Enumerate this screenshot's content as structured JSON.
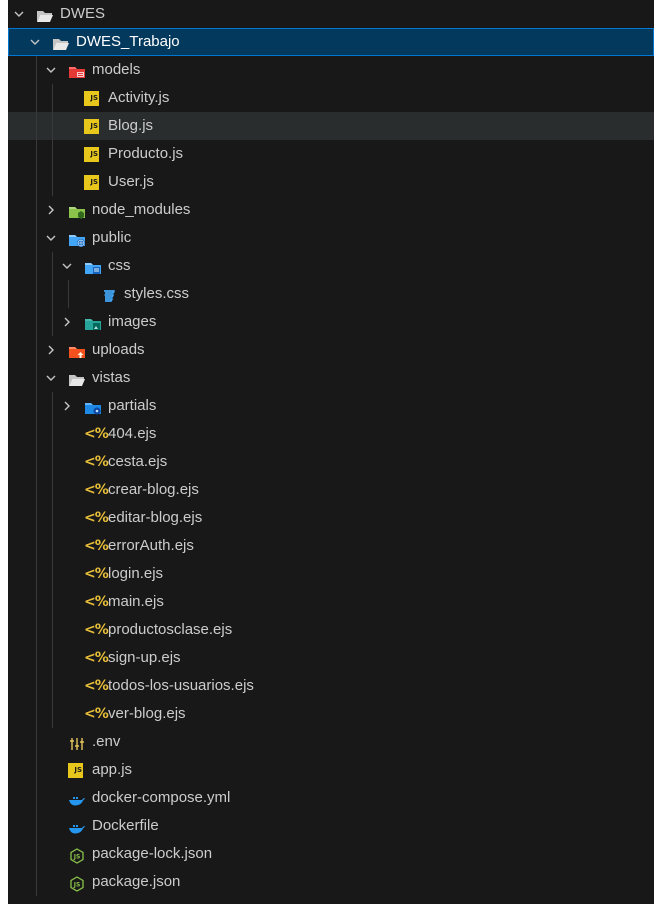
{
  "tree": [
    {
      "label": "DWES",
      "depth": 0,
      "kind": "folder",
      "icon": "folder-open-icon",
      "expanded": true
    },
    {
      "label": "DWES_Trabajo",
      "depth": 1,
      "kind": "folder",
      "icon": "folder-open-icon",
      "expanded": true,
      "selected": true
    },
    {
      "label": "models",
      "depth": 2,
      "kind": "folder",
      "icon": "models-folder-icon",
      "expanded": true
    },
    {
      "label": "Activity.js",
      "depth": 3,
      "kind": "file",
      "icon": "js-file-icon"
    },
    {
      "label": "Blog.js",
      "depth": 3,
      "kind": "file",
      "icon": "js-file-icon",
      "hover": true
    },
    {
      "label": "Producto.js",
      "depth": 3,
      "kind": "file",
      "icon": "js-file-icon"
    },
    {
      "label": "User.js",
      "depth": 3,
      "kind": "file",
      "icon": "js-file-icon"
    },
    {
      "label": "node_modules",
      "depth": 2,
      "kind": "folder",
      "icon": "node-modules-folder-icon",
      "expanded": false
    },
    {
      "label": "public",
      "depth": 2,
      "kind": "folder",
      "icon": "public-folder-icon",
      "expanded": true
    },
    {
      "label": "css",
      "depth": 3,
      "kind": "folder",
      "icon": "css-folder-icon",
      "expanded": true
    },
    {
      "label": "styles.css",
      "depth": 4,
      "kind": "file",
      "icon": "css-file-icon"
    },
    {
      "label": "images",
      "depth": 3,
      "kind": "folder",
      "icon": "images-folder-icon",
      "expanded": false
    },
    {
      "label": "uploads",
      "depth": 2,
      "kind": "folder",
      "icon": "uploads-folder-icon",
      "expanded": false
    },
    {
      "label": "vistas",
      "depth": 2,
      "kind": "folder",
      "icon": "folder-open-icon",
      "expanded": true
    },
    {
      "label": "partials",
      "depth": 3,
      "kind": "folder",
      "icon": "partials-folder-icon",
      "expanded": false
    },
    {
      "label": "404.ejs",
      "depth": 3,
      "kind": "file",
      "icon": "ejs-file-icon"
    },
    {
      "label": "cesta.ejs",
      "depth": 3,
      "kind": "file",
      "icon": "ejs-file-icon"
    },
    {
      "label": "crear-blog.ejs",
      "depth": 3,
      "kind": "file",
      "icon": "ejs-file-icon"
    },
    {
      "label": "editar-blog.ejs",
      "depth": 3,
      "kind": "file",
      "icon": "ejs-file-icon"
    },
    {
      "label": "errorAuth.ejs",
      "depth": 3,
      "kind": "file",
      "icon": "ejs-file-icon"
    },
    {
      "label": "login.ejs",
      "depth": 3,
      "kind": "file",
      "icon": "ejs-file-icon"
    },
    {
      "label": "main.ejs",
      "depth": 3,
      "kind": "file",
      "icon": "ejs-file-icon"
    },
    {
      "label": "productosclase.ejs",
      "depth": 3,
      "kind": "file",
      "icon": "ejs-file-icon"
    },
    {
      "label": "sign-up.ejs",
      "depth": 3,
      "kind": "file",
      "icon": "ejs-file-icon"
    },
    {
      "label": "todos-los-usuarios.ejs",
      "depth": 3,
      "kind": "file",
      "icon": "ejs-file-icon"
    },
    {
      "label": "ver-blog.ejs",
      "depth": 3,
      "kind": "file",
      "icon": "ejs-file-icon"
    },
    {
      "label": ".env",
      "depth": 2,
      "kind": "file",
      "icon": "env-file-icon"
    },
    {
      "label": "app.js",
      "depth": 2,
      "kind": "file",
      "icon": "js-file-icon"
    },
    {
      "label": "docker-compose.yml",
      "depth": 2,
      "kind": "file",
      "icon": "docker-icon"
    },
    {
      "label": "Dockerfile",
      "depth": 2,
      "kind": "file",
      "icon": "docker-icon"
    },
    {
      "label": "package-lock.json",
      "depth": 2,
      "kind": "file",
      "icon": "npm-json-icon"
    },
    {
      "label": "package.json",
      "depth": 2,
      "kind": "file",
      "icon": "npm-json-icon"
    }
  ],
  "colors": {
    "background": "#181818",
    "text": "#cccccc",
    "selection": "#04395e",
    "selection_border": "#0078d4",
    "hover": "#2a2d2e",
    "js_badge": "#e8c71c",
    "ejs": "#e8bf3a",
    "css": "#42a5f5",
    "docker": "#2496ed",
    "npm_json": "#8bc34a"
  }
}
